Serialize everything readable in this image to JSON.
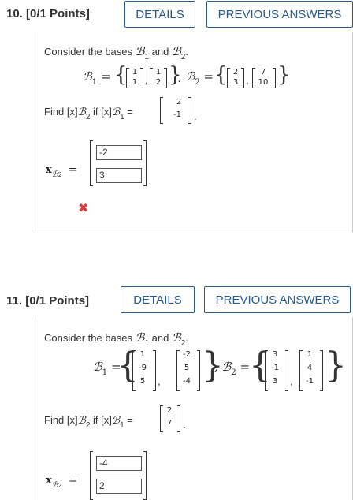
{
  "q10": {
    "number": "10.",
    "points": "[0/1 Points]",
    "details": "DETAILS",
    "previous": "PREVIOUS ANSWERS",
    "intro_a": "Consider the bases",
    "intro_and": "and",
    "b1_label": "B",
    "b2_label": "B",
    "sub1": "1",
    "sub2": "2",
    "eq": "=",
    "find_a": "Find [x]",
    "find_if": "if [x]",
    "b1_vectors": [
      [
        "1",
        "1"
      ],
      [
        "1",
        "2"
      ]
    ],
    "b2_vectors": [
      [
        "2",
        "3"
      ],
      [
        "7",
        "10"
      ]
    ],
    "given": [
      "2",
      "-1"
    ],
    "answers": [
      "-2",
      "3"
    ],
    "xlabel": "x",
    "status": "incorrect"
  },
  "q11": {
    "number": "11.",
    "points": "[0/1 Points]",
    "details": "DETAILS",
    "previous": "PREVIOUS ANSWERS",
    "intro_a": "Consider the bases",
    "intro_and": "and",
    "b1_vectors": [
      [
        "1",
        "-9",
        "5"
      ],
      [
        "-2",
        "5",
        "-4"
      ]
    ],
    "b2_vectors": [
      [
        "3",
        "-1",
        "3"
      ],
      [
        "1",
        "4",
        "-1"
      ]
    ],
    "given": [
      "2",
      "7"
    ],
    "answers": [
      "-4",
      "2"
    ]
  }
}
